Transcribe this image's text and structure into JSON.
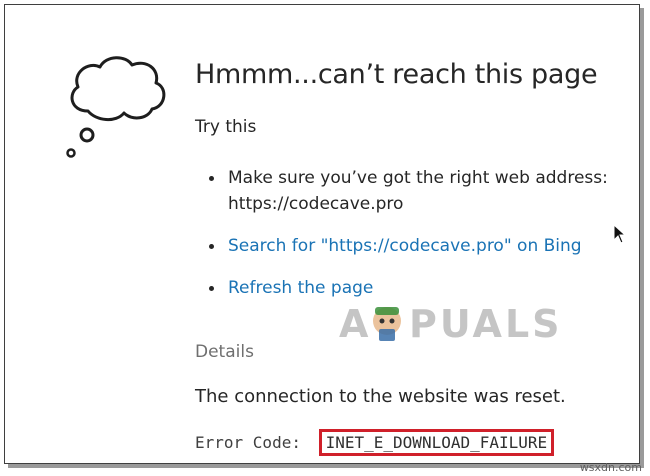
{
  "page": {
    "title": "Hmmm...can’t reach this page",
    "try_this": "Try this",
    "suggestions": {
      "address_line1": "Make sure you’ve got the right web address:",
      "address_line2": "https://codecave.pro",
      "search_link": "Search for \"https://codecave.pro\" on Bing",
      "refresh_link": "Refresh the page"
    },
    "details_heading": "Details",
    "details_message": "The connection to the website was reset.",
    "error_label": "Error Code:",
    "error_code": "INET_E_DOWNLOAD_FAILURE"
  },
  "watermarks": {
    "logo_text": "APPUALS",
    "site": "wsxdn.com"
  },
  "icons": {
    "cloud": "thought-cloud-icon",
    "cursor": "mouse-pointer-icon"
  },
  "colors": {
    "link": "#1a73b5",
    "highlight_box": "#d0202a",
    "text": "#262626",
    "muted": "#6f6f6f"
  }
}
